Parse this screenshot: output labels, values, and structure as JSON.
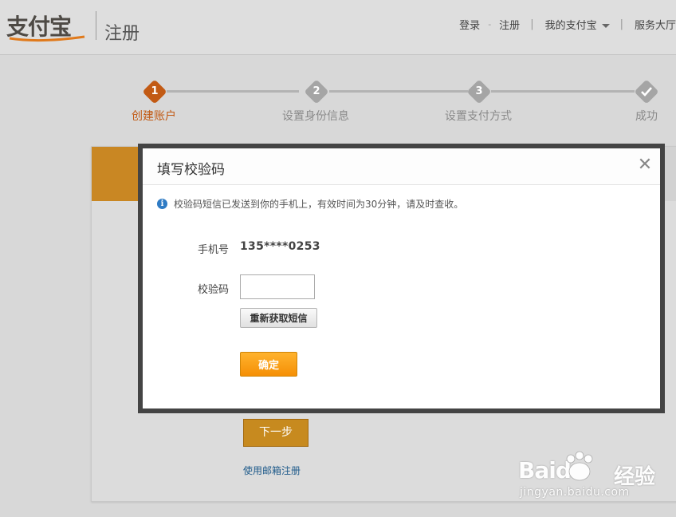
{
  "header": {
    "logo_text": "支付宝",
    "page_name": "注册",
    "nav": {
      "login": "登录",
      "separator": "-",
      "register": "注册",
      "my_alipay": "我的支付宝",
      "service_hall": "服务大厅"
    }
  },
  "steps": [
    {
      "num": "1",
      "label": "创建账户",
      "state": "active"
    },
    {
      "num": "2",
      "label": "设置身份信息",
      "state": "pending"
    },
    {
      "num": "3",
      "label": "设置支付方式",
      "state": "pending"
    },
    {
      "num": "",
      "label": "成功",
      "state": "pending",
      "icon": "checkmark-icon"
    }
  ],
  "form": {
    "next_label": "下一步",
    "email_register_label": "使用邮箱注册"
  },
  "dialog": {
    "title": "填写校验码",
    "close_glyph": "✕",
    "notice": "校验码短信已发送到你的手机上，有效时间为30分钟，请及时查收。",
    "phone_label": "手机号",
    "phone_value": "135****0253",
    "code_label": "校验码",
    "code_value": "",
    "resend_label": "重新获取短信",
    "confirm_label": "确定"
  },
  "watermark": {
    "brand": "Baidu",
    "brand_cn": "经验",
    "url": "jingyan.baidu.com"
  },
  "colors": {
    "accent_active": "#c25a14",
    "confirm_button": "#f89a12",
    "info_icon": "#2f7bc4"
  }
}
